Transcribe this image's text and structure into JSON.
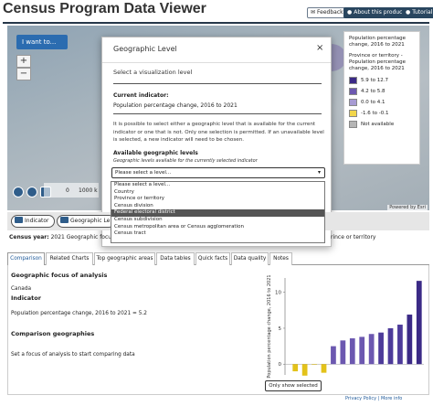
{
  "header": {
    "title": "Census Program Data Viewer",
    "feedback_label": "Feedback",
    "about_label": "About this product",
    "tutorial_label": "Tutorial"
  },
  "map": {
    "i_want_label": "I want to...",
    "zoom_in": "+",
    "zoom_out": "−",
    "scale_left": "0",
    "scale_right": "1000 k",
    "powered_by": "Powered by Esri"
  },
  "legend": {
    "title": "Population percentage change, 2016 to 2021",
    "subtitle": "Province or territory - Population percentage change, 2016 to 2021",
    "items": [
      {
        "label": "5.9 to 12.7",
        "color": "#3b2a86"
      },
      {
        "label": "4.2 to 5.8",
        "color": "#6c58b0"
      },
      {
        "label": "0.0 to 4.1",
        "color": "#a79bd3"
      },
      {
        "label": "-1.6 to -0.1",
        "color": "#f2d64b"
      },
      {
        "label": "Not available",
        "color": "#b5b5b5"
      }
    ]
  },
  "modal": {
    "title": "Geographic Level",
    "subtitle": "Select a visualization level",
    "current_indicator_label": "Current indicator:",
    "current_indicator_value": "Population percentage change, 2016 to 2021",
    "paragraph": "It is possible to select either a geographic level that is available for the current indicator or one that is not. Only one selection is permitted. If an unavailable level is selected, a new indicator will need to be chosen.",
    "available_label": "Available geographic levels",
    "available_hint": "Geographic levels available for the currently selected indicator",
    "select_value": "Please select a level...",
    "close": "×"
  },
  "dropdown": {
    "options": [
      {
        "label": "Please select a level...",
        "selected": false
      },
      {
        "label": "Country",
        "selected": false
      },
      {
        "label": "Province or territory",
        "selected": false
      },
      {
        "label": "Census division",
        "selected": false
      },
      {
        "label": "Federal electoral district",
        "selected": true
      },
      {
        "label": "Census subdivision",
        "selected": false
      },
      {
        "label": "Census metropolitan area or Census agglomeration",
        "selected": false
      },
      {
        "label": "Census tract",
        "selected": false
      }
    ]
  },
  "toolbar": {
    "indicator_label": "Indicator",
    "geo_level_label": "Geographic Le"
  },
  "info": {
    "census_year_label": "Census year:",
    "census_year_value": "2021 Geographic focus",
    "geo_right": "rince or territory"
  },
  "tabs": [
    {
      "label": "Comparison",
      "active": true
    },
    {
      "label": "Related Charts",
      "active": false
    },
    {
      "label": "Top geographic areas",
      "active": false
    },
    {
      "label": "Data tables",
      "active": false
    },
    {
      "label": "Quick facts",
      "active": false
    },
    {
      "label": "Data quality",
      "active": false
    },
    {
      "label": "Notes",
      "active": false
    }
  ],
  "panel": {
    "geo_focus_heading": "Geographic focus of analysis",
    "geo_focus_value": "Canada",
    "indicator_heading": "Indicator",
    "indicator_value": "Population percentage change, 2016 to 2021 = 5.2",
    "comparison_heading": "Comparison geographies",
    "comparison_text": "Set a focus of analysis to start comparing data",
    "only_selected_label": "Only show selected"
  },
  "chart_data": {
    "type": "bar",
    "ylabel": "Population percentage change, 2016 to 2021",
    "ylim": [
      -1.5,
      12
    ],
    "yticks": [
      10,
      5,
      0
    ],
    "values": [
      -1.0,
      -1.6,
      0.0,
      -1.2,
      2.5,
      3.3,
      3.6,
      3.8,
      4.2,
      4.4,
      5.0,
      5.5,
      6.9,
      11.6
    ],
    "colors": [
      "#e3c21a",
      "#e3c21a",
      "#e3c21a",
      "#e3c21a",
      "#6c58b0",
      "#6c58b0",
      "#6c58b0",
      "#6c58b0",
      "#6c58b0",
      "#4d3b9a",
      "#4d3b9a",
      "#4d3b9a",
      "#3b2a86",
      "#3b2a86"
    ]
  },
  "footer": {
    "privacy": "Privacy Policy",
    "more": "More info"
  }
}
